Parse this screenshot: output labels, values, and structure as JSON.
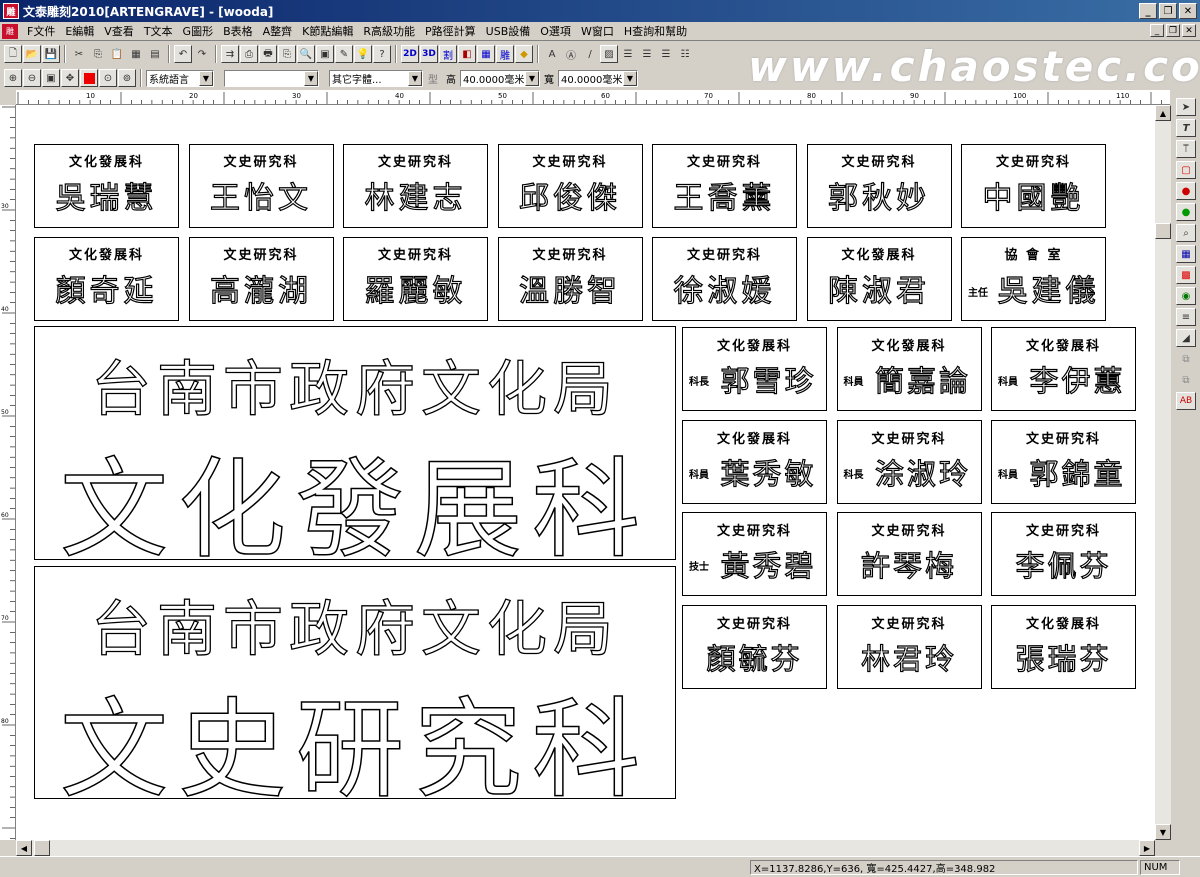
{
  "window": {
    "title": "文泰雕刻2010[ARTENGRAVE] - [wooda]",
    "app_icon": "雕"
  },
  "menu": [
    "F文件",
    "E編輯",
    "V查看",
    "T文本",
    "G圖形",
    "B表格",
    "A整齊",
    "K節點編輯",
    "R高級功能",
    "P路徑計算",
    "USB設備",
    "O選項",
    "W窗口",
    "H查詢和幫助"
  ],
  "toolbar2": {
    "language": "系統語言",
    "font_blank": "",
    "font_other": "其它字體...",
    "height_label": "高",
    "height_value": "40.0000毫米",
    "width_label": "寬",
    "width_value": "40.0000毫米"
  },
  "watermark": "www.chaostec.com",
  "ruler_h": [
    "10",
    "20",
    "30",
    "40",
    "50",
    "60",
    "70",
    "80",
    "90",
    "100",
    "110"
  ],
  "ruler_v": [
    "30",
    "40",
    "50",
    "60",
    "70",
    "80"
  ],
  "plates_row1": [
    {
      "top": "文化發展科",
      "name": "吳瑞慧"
    },
    {
      "top": "文史研究科",
      "name": "王怡文"
    },
    {
      "top": "文史研究科",
      "name": "林建志"
    },
    {
      "top": "文史研究科",
      "name": "邱俊傑"
    },
    {
      "top": "文史研究科",
      "name": "王喬薰"
    },
    {
      "top": "文史研究科",
      "name": "郭秋妙"
    },
    {
      "top": "文史研究科",
      "name": "中國艷"
    }
  ],
  "plates_row2": [
    {
      "top": "文化發展科",
      "name": "顏奇延"
    },
    {
      "top": "文史研究科",
      "name": "高瀧湖"
    },
    {
      "top": "文史研究科",
      "name": "羅麗敏"
    },
    {
      "top": "文史研究科",
      "name": "溫勝智"
    },
    {
      "top": "文史研究科",
      "name": "徐淑媛"
    },
    {
      "top": "文化發展科",
      "name": "陳淑君"
    },
    {
      "top": "協 會 室",
      "role": "主任",
      "name": "吳建儀"
    }
  ],
  "big_plates": [
    {
      "line1": "台南市政府文化局",
      "line2": "文化發展科"
    },
    {
      "line1": "台南市政府文化局",
      "line2": "文史研究科"
    }
  ],
  "plates_grid": [
    {
      "top": "文化發展科",
      "role": "科長",
      "name": "郭雪珍"
    },
    {
      "top": "文化發展科",
      "role": "科員",
      "name": "簡嘉論"
    },
    {
      "top": "文化發展科",
      "role": "科員",
      "name": "李伊蕙"
    },
    {
      "top": "文化發展科",
      "role": "科員",
      "name": "葉秀敏"
    },
    {
      "top": "文史研究科",
      "role": "科長",
      "name": "涂淑玲"
    },
    {
      "top": "文史研究科",
      "role": "科員",
      "name": "郭錦童"
    },
    {
      "top": "文史研究科",
      "role": "技士",
      "name": "黃秀碧"
    },
    {
      "top": "文史研究科",
      "name": "許琴梅"
    },
    {
      "top": "文史研究科",
      "name": "李佩芬"
    },
    {
      "top": "文史研究科",
      "name": "顏毓芬"
    },
    {
      "top": "文史研究科",
      "name": "林君玲"
    },
    {
      "top": "文化發展科",
      "name": "張瑞芬"
    }
  ],
  "status": {
    "coords": "X=1137.8286,Y=636, 寬=425.4427,高=348.982",
    "num": "NUM"
  }
}
